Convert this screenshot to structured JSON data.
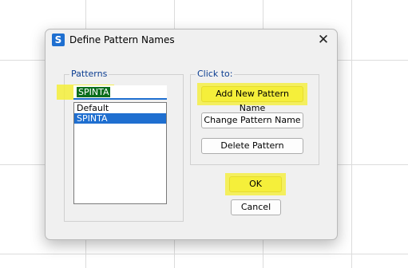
{
  "dialog": {
    "app_icon": "S",
    "title": "Define Pattern Names",
    "close_glyph": "✕"
  },
  "patterns": {
    "legend": "Patterns",
    "input_value": "SPINTA",
    "items": [
      "Default",
      "SPINTA"
    ],
    "selected_index": 1
  },
  "click_to": {
    "legend": "Click to:",
    "add_label": "Add New Pattern Name",
    "change_label": "Change Pattern Name",
    "delete_label": "Delete Pattern"
  },
  "footer": {
    "ok_label": "OK",
    "cancel_label": "Cancel"
  },
  "colors": {
    "accent": "#1f6fd0",
    "highlight": "#f5ef3a",
    "input_selection": "#0b6d1c"
  }
}
